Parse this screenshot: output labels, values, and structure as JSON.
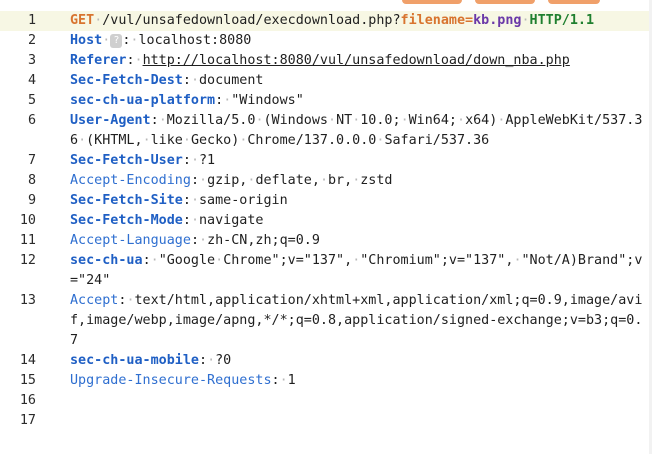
{
  "lines": [
    {
      "num": "1",
      "method": "GET",
      "path": "/vul/unsafedownload/execdownload.php?",
      "param_name": "filename",
      "param_eq": "=",
      "param_value": "kb.png",
      "protocol": "HTTP/1.1"
    },
    {
      "num": "2",
      "name": "Host",
      "badge": "?",
      "value": "localhost:8080"
    },
    {
      "num": "3",
      "name": "Referer",
      "value": "http://localhost:8080/vul/unsafedownload/down_nba.php"
    },
    {
      "num": "4",
      "name": "Sec-Fetch-Dest",
      "value": "document"
    },
    {
      "num": "5",
      "name": "sec-ch-ua-platform",
      "value": "\"Windows\""
    },
    {
      "num": "6",
      "name": "User-Agent",
      "value": "Mozilla/5.0 (Windows NT 10.0; Win64; x64) AppleWebKit/537.36 (KHTML, like Gecko) Chrome/137.0.0.0 Safari/537.36"
    },
    {
      "num": "7",
      "name": "Sec-Fetch-User",
      "value": "?1"
    },
    {
      "num": "8",
      "name": "Accept-Encoding",
      "value": "gzip, deflate, br, zstd"
    },
    {
      "num": "9",
      "name": "Sec-Fetch-Site",
      "value": "same-origin"
    },
    {
      "num": "10",
      "name": "Sec-Fetch-Mode",
      "value": "navigate"
    },
    {
      "num": "11",
      "name": "Accept-Language",
      "value": "zh-CN,zh;q=0.9"
    },
    {
      "num": "12",
      "name": "sec-ch-ua",
      "value": "\"Google Chrome\";v=\"137\", \"Chromium\";v=\"137\", \"Not/A)Brand\";v=\"24\""
    },
    {
      "num": "13",
      "name": "Accept",
      "value": "text/html,application/xhtml+xml,application/xml;q=0.9,image/avif,image/webp,image/apng,*/*;q=0.8,application/signed-exchange;v=b3;q=0.7"
    },
    {
      "num": "14",
      "name": "sec-ch-ua-mobile",
      "value": "?0"
    },
    {
      "num": "15",
      "name": "Upgrade-Insecure-Requests",
      "value": "1"
    },
    {
      "num": "16"
    },
    {
      "num": "17"
    }
  ],
  "colors": {
    "method": "#d8742f",
    "param_value": "#6a38a8",
    "protocol": "#1f7f2f",
    "header_name": "#1f5fc4",
    "highlight_line": "#f7f7e4",
    "tab_accent": "#f0a06a"
  }
}
